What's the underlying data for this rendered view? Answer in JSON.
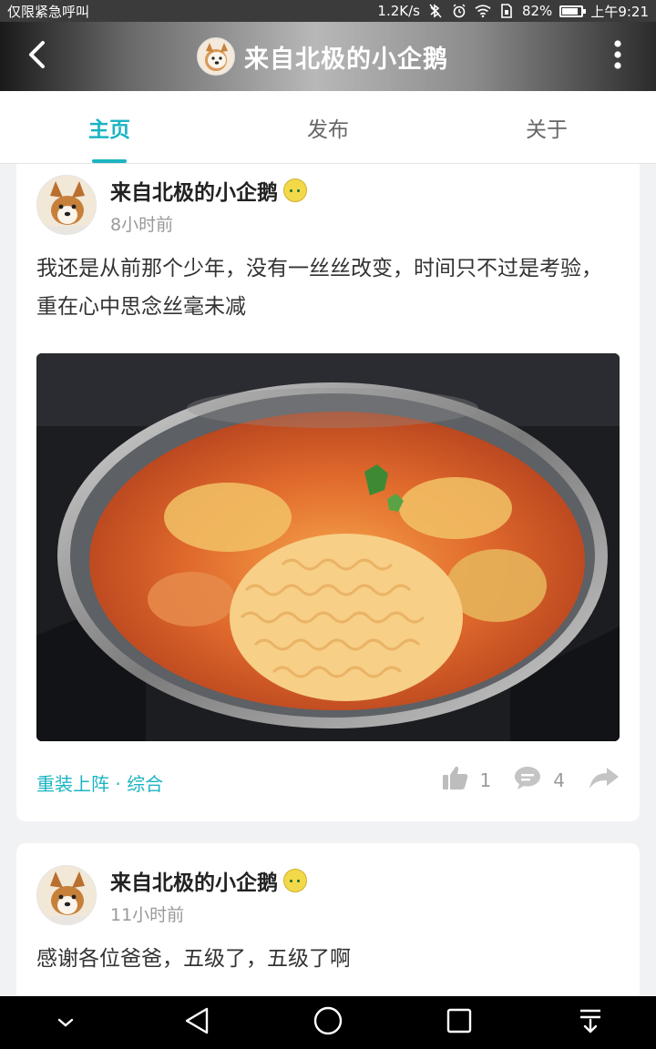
{
  "status_bar": {
    "left_text": "仅限紧急呼叫",
    "network_speed": "1.2K/s",
    "battery": "82%",
    "battery_level": 0.82,
    "time": "上午9:21",
    "icons": [
      "bluetooth-off-icon",
      "alarm-icon",
      "wifi-icon",
      "sim-icon",
      "battery-icon"
    ]
  },
  "app_bar": {
    "title": "来自北极的小企鹅",
    "back_icon": "back-arrow-icon",
    "menu_icon": "more-vertical-icon"
  },
  "tabs": [
    {
      "label": "主页",
      "active": true
    },
    {
      "label": "发布",
      "active": false
    },
    {
      "label": "关于",
      "active": false
    }
  ],
  "posts": [
    {
      "author": "来自北极的小企鹅",
      "time": "8小时前",
      "text": "我还是从前那个少年，没有一丝丝改变，时间只不过是考验，重在心中思念丝毫未减",
      "image_alt": "",
      "tags": "重装上阵 · 综合",
      "likes": "1",
      "comments": "4"
    },
    {
      "author": "来自北极的小企鹅",
      "time": "11小时前",
      "text": "感谢各位爸爸，五级了，五级了啊"
    }
  ],
  "colors": {
    "accent": "#1cb4c3",
    "text_primary": "#222222",
    "text_secondary": "#999999",
    "background": "#f1f2f4"
  },
  "nav_bar": {
    "icons": [
      "nav-collapse-icon",
      "nav-back-icon",
      "nav-home-icon",
      "nav-recents-icon",
      "nav-notification-icon"
    ]
  }
}
